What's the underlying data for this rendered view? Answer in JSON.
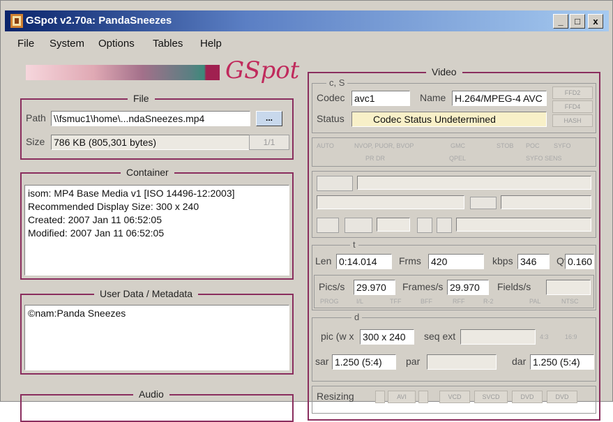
{
  "window": {
    "title": "GSpot v2.70a: PandaSneezes",
    "controls": {
      "minimize": "_",
      "maximize": "□",
      "close": "x"
    }
  },
  "menu": [
    "File",
    "System",
    "Options",
    "Tables",
    "Help"
  ],
  "logo_text": "GSpot",
  "file": {
    "legend": "File",
    "path_label": "Path",
    "path_value": "\\\\fsmuc1\\home\\...ndaSneezes.mp4",
    "browse_label": "...",
    "size_label": "Size",
    "size_value": "786 KB (805,301 bytes)",
    "page_counter": "1/1"
  },
  "container": {
    "legend": "Container",
    "lines": [
      "isom: MP4  Base Media v1 [ISO 14496-12:2003]",
      "Recommended Display Size: 300 x 240",
      "Created:   2007 Jan 11   06:52:05",
      "Modified:  2007 Jan 11   06:52:05"
    ]
  },
  "metadata": {
    "legend": "User Data / Metadata",
    "lines": [
      "©nam:Panda Sneezes"
    ]
  },
  "audio": {
    "legend": "Audio"
  },
  "video": {
    "legend": "Video",
    "codec_section": "c, S",
    "codec_label": "Codec",
    "codec_value": "avc1",
    "name_label": "Name",
    "name_value": "H.264/MPEG-4 AVC",
    "status_label": "Status",
    "status_value": "Codec Status Undetermined",
    "side_buttons": [
      "FFD2",
      "FFD4",
      "HASH"
    ],
    "ghost_row_1": [
      "AUTO",
      "NVOP, PUOR, BVOP",
      "QPEL",
      "GMC",
      "STOB",
      "POC",
      "SYFO"
    ],
    "ghost_row_2": [
      "PR DR",
      "SYFO SENS"
    ],
    "time_section": "t",
    "len_label": "Len",
    "len_value": "0:14.014",
    "frms_label": "Frms",
    "frms_value": "420",
    "kbps_label": "kbps",
    "kbps_value": "346",
    "qf_label": "Qf",
    "qf_value": "0.160",
    "pics_label": "Pics/s",
    "pics_value": "29.970",
    "frames_label": "Frames/s",
    "frames_value": "29.970",
    "fields_label": "Fields/s",
    "fields_value": "",
    "ghost_row_3": [
      "PROG",
      "I/L",
      "TFF",
      "BFF",
      "RFF",
      "R-2",
      "PAL",
      "NTSC"
    ],
    "dim_section": "d",
    "pic_label": "pic (w x",
    "pic_value": "300 x 240",
    "seq_label": "seq ext",
    "seq_value": "",
    "ratio_buttons": [
      "4:3",
      "16:9"
    ],
    "sar_label": "sar",
    "sar_value": "1.250 (5:4)",
    "par_label": "par",
    "par_value": "",
    "dar_label": "dar",
    "dar_value": "1.250 (5:4)",
    "resizing_label": "Resizing",
    "resize_buttons": [
      "AVI",
      "VCD",
      "SVCD",
      "DVD",
      "DVD"
    ]
  }
}
